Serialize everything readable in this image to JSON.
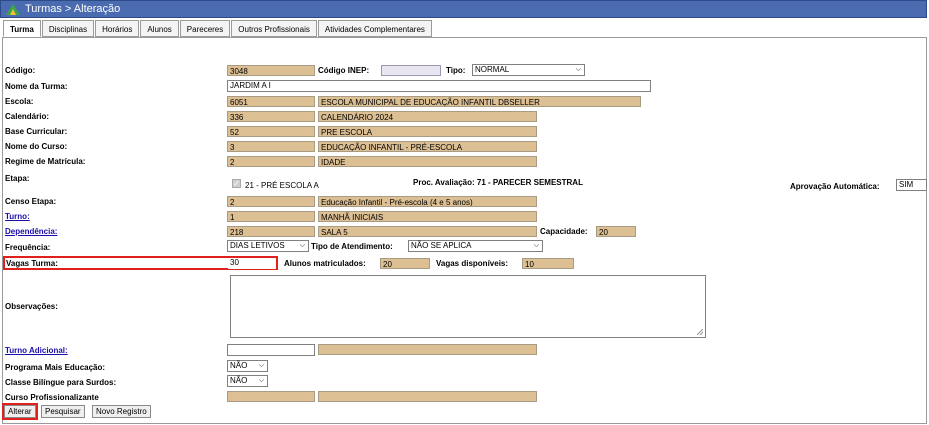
{
  "window": {
    "title": "Turmas > Alteração"
  },
  "tabs": [
    "Turma",
    "Disciplinas",
    "Horários",
    "Alunos",
    "Pareceres",
    "Outros Profissionais",
    "Atividades Complementares"
  ],
  "form": {
    "codigo": {
      "label": "Código:",
      "value": "3048"
    },
    "codigo_inep": {
      "label": "Código INEP:",
      "value": ""
    },
    "tipo": {
      "label": "Tipo:",
      "value": "NORMAL"
    },
    "nome_turma": {
      "label": "Nome da Turma:",
      "value": "JARDIM A I"
    },
    "escola": {
      "label": "Escola:",
      "code": "6051",
      "value": "ESCOLA MUNICIPAL DE EDUCAÇÃO INFANTIL DBSELLER"
    },
    "calendario": {
      "label": "Calendário:",
      "code": "336",
      "value": "CALENDÁRIO 2024"
    },
    "base_curricular": {
      "label": "Base Curricular:",
      "code": "52",
      "value": "PRE ESCOLA"
    },
    "nome_curso": {
      "label": "Nome do Curso:",
      "code": "3",
      "value": "EDUCAÇÃO INFANTIL - PRÉ-ESCOLA"
    },
    "regime_matricula": {
      "label": "Regime de Matrícula:",
      "code": "2",
      "value": "IDADE"
    },
    "etapa": {
      "label": "Etapa:",
      "value": "21 - PRÉ ESCOLA A",
      "proc_avaliacao": "Proc. Avaliação: 71 - PARECER SEMESTRAL"
    },
    "aprovacao_automatica": {
      "label": "Aprovação Automática:",
      "value": "SIM"
    },
    "censo_etapa": {
      "label": "Censo Etapa:",
      "code": "2",
      "value": "Educação Infantil - Pré-escola (4 e 5 anos)"
    },
    "turno": {
      "label": "Turno:",
      "code": "1",
      "value": "MANHÃ INICIAIS"
    },
    "dependencia": {
      "label": "Dependência:",
      "code": "218",
      "value": "SALA 5"
    },
    "capacidade": {
      "label": "Capacidade:",
      "value": "20"
    },
    "frequencia": {
      "label": "Frequência:",
      "value": "DIAS LETIVOS"
    },
    "tipo_atendimento": {
      "label": "Tipo de Atendimento:",
      "value": "NÃO SE APLICA"
    },
    "vagas_turma": {
      "label": "Vagas Turma:",
      "value": "30"
    },
    "alunos_matriculados": {
      "label": "Alunos matriculados:",
      "value": "20"
    },
    "vagas_disponiveis": {
      "label": "Vagas disponíveis:",
      "value": "10"
    },
    "observacoes": {
      "label": "Observações:",
      "value": ""
    },
    "turno_adicional": {
      "label": "Turno Adicional:",
      "code": "",
      "value": ""
    },
    "programa_mais_educacao": {
      "label": "Programa Mais Educação:",
      "value": "NÃO"
    },
    "classe_bilingue": {
      "label": "Classe Bilíngue para Surdos:",
      "value": "NÃO"
    },
    "curso_profissionalizante": {
      "label": "Curso Profissionalizante",
      "code": "",
      "value": ""
    }
  },
  "buttons": {
    "alterar": "Alterar",
    "pesquisar": "Pesquisar",
    "novo_registro": "Novo Registro"
  },
  "colors": {
    "readonly_field": "#ddbf94",
    "titlebar": "#4a6bb0",
    "highlight": "#e0201a",
    "link": "#1a0dab"
  }
}
